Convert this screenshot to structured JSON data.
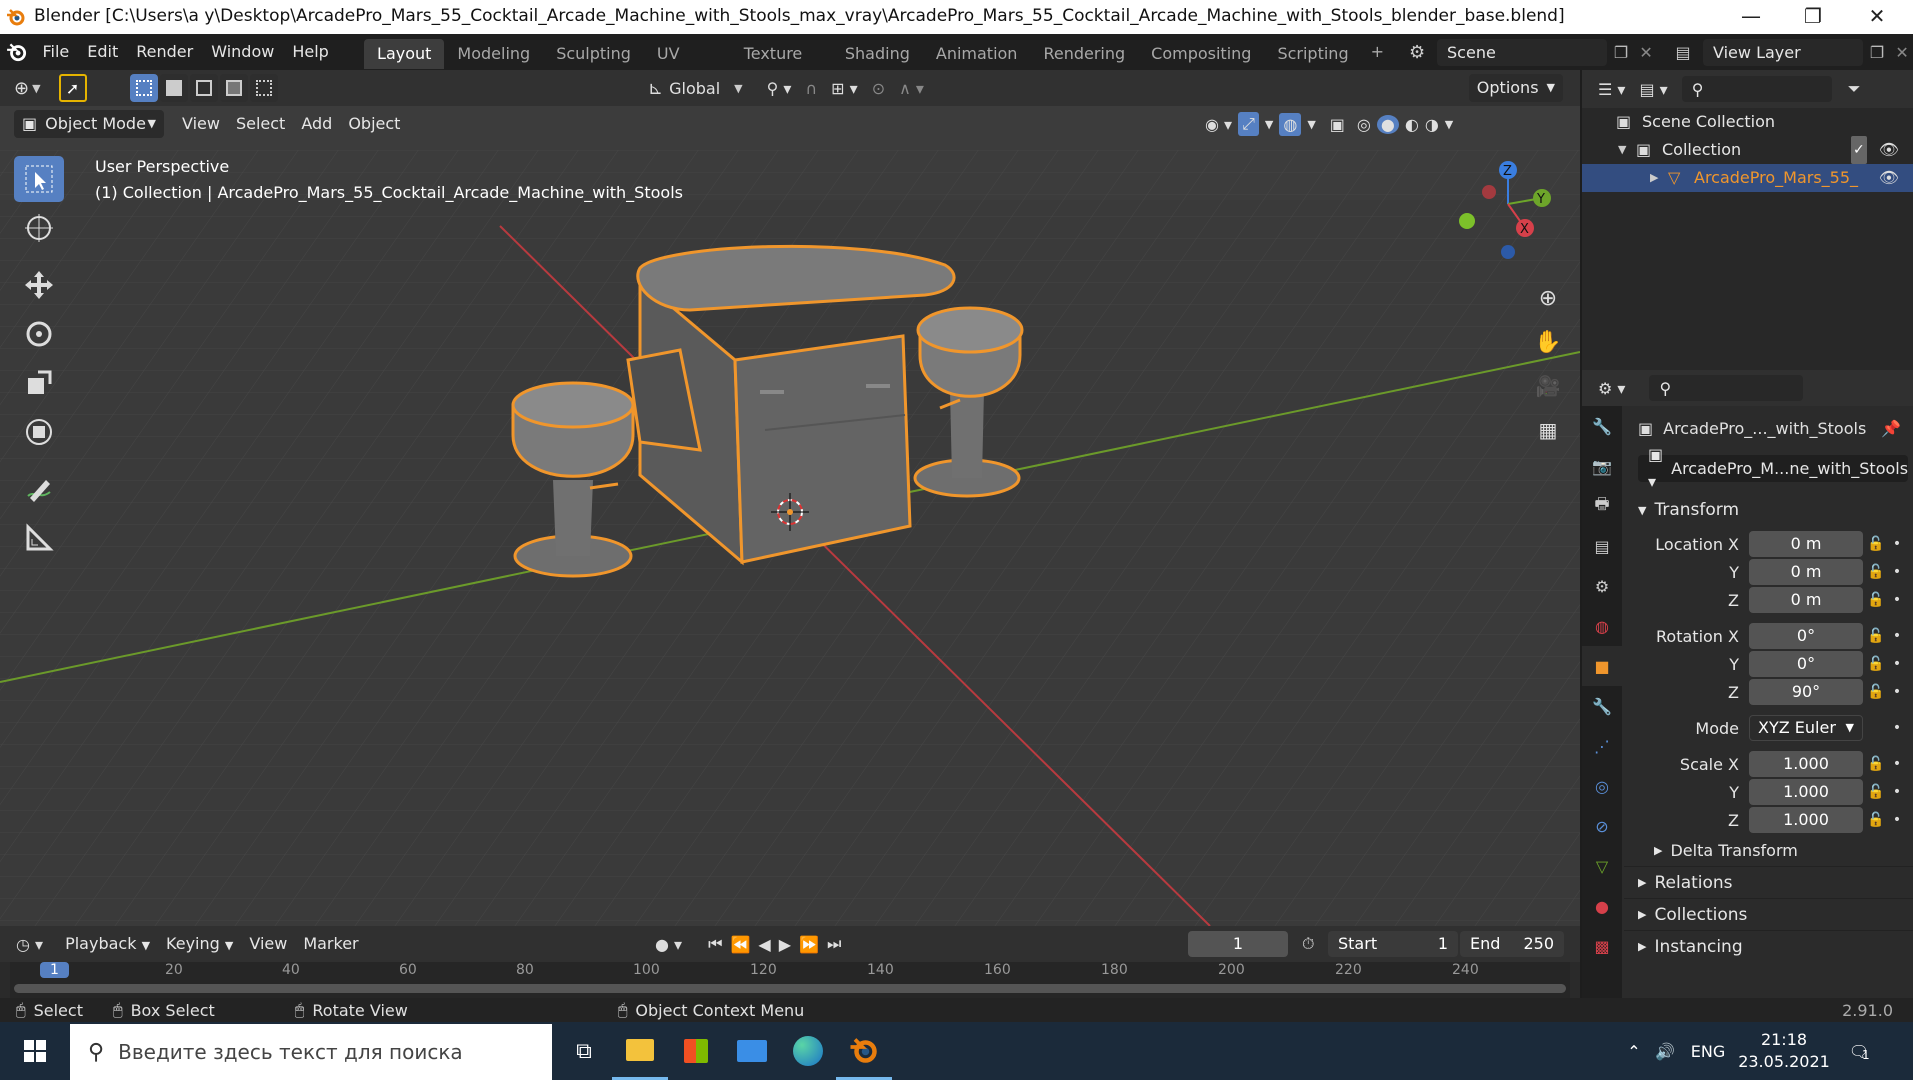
{
  "window": {
    "title": "Blender [C:\\Users\\a y\\Desktop\\ArcadePro_Mars_55_Cocktail_Arcade_Machine_with_Stools_max_vray\\ArcadePro_Mars_55_Cocktail_Arcade_Machine_with_Stools_blender_base.blend]",
    "minimize": "—",
    "maximize": "❐",
    "close": "✕"
  },
  "menu": [
    "File",
    "Edit",
    "Render",
    "Window",
    "Help"
  ],
  "workspaces": [
    "Layout",
    "Modeling",
    "Sculpting",
    "UV Editing",
    "Texture Paint",
    "Shading",
    "Animation",
    "Rendering",
    "Compositing",
    "Scripting"
  ],
  "workspace_add": "+",
  "scene": {
    "name": "Scene",
    "view_layer": "View Layer"
  },
  "viewport_header": {
    "mode": "Object Mode",
    "menus": [
      "View",
      "Select",
      "Add",
      "Object"
    ],
    "orientation": "Global",
    "options": "Options"
  },
  "viewport": {
    "perspective": "User Perspective",
    "collection_info": "(1) Collection | ArcadePro_Mars_55_Cocktail_Arcade_Machine_with_Stools"
  },
  "gizmo": {
    "x": "X",
    "y": "Y",
    "z": "Z"
  },
  "outliner": {
    "rows": [
      {
        "label": "Scene Collection"
      },
      {
        "label": "Collection"
      },
      {
        "label": "ArcadePro_Mars_55_"
      }
    ]
  },
  "properties": {
    "object_name": "ArcadePro_..._with_Stools",
    "data_name": "ArcadePro_M...ne_with_Stools",
    "transform_title": "Transform",
    "location": {
      "label": "Location X",
      "x": "0 m",
      "y": "0 m",
      "z": "0 m"
    },
    "rotation": {
      "label": "Rotation X",
      "x": "0°",
      "y": "0°",
      "z": "90°"
    },
    "mode": {
      "label": "Mode",
      "value": "XYZ Euler"
    },
    "scale": {
      "label": "Scale X",
      "x": "1.000",
      "y": "1.000",
      "z": "1.000"
    },
    "axis_labels": {
      "y": "Y",
      "z": "Z"
    },
    "subpanels": [
      "Delta Transform",
      "Relations",
      "Collections",
      "Instancing"
    ]
  },
  "timeline": {
    "menus": [
      "Playback",
      "Keying",
      "View",
      "Marker"
    ],
    "current_frame": "1",
    "start_label": "Start",
    "start": "1",
    "end_label": "End",
    "end": "250",
    "ruler": [
      "1",
      "20",
      "40",
      "60",
      "80",
      "100",
      "120",
      "140",
      "160",
      "180",
      "200",
      "220",
      "240"
    ]
  },
  "statusbar": {
    "select": "Select",
    "box_select": "Box Select",
    "rotate_view": "Rotate View",
    "context_menu": "Object Context Menu",
    "version": "2.91.0"
  },
  "taskbar": {
    "search_placeholder": "Введите здесь текст для поиска",
    "lang": "ENG",
    "time": "21:18",
    "date": "23.05.2021",
    "notifications": "1"
  },
  "colors": {
    "accent": "#5680c2",
    "selection_outline": "#f0962c",
    "x_axis": "#d6404a",
    "y_axis": "#6da52a",
    "z_axis": "#3a7ee0"
  }
}
